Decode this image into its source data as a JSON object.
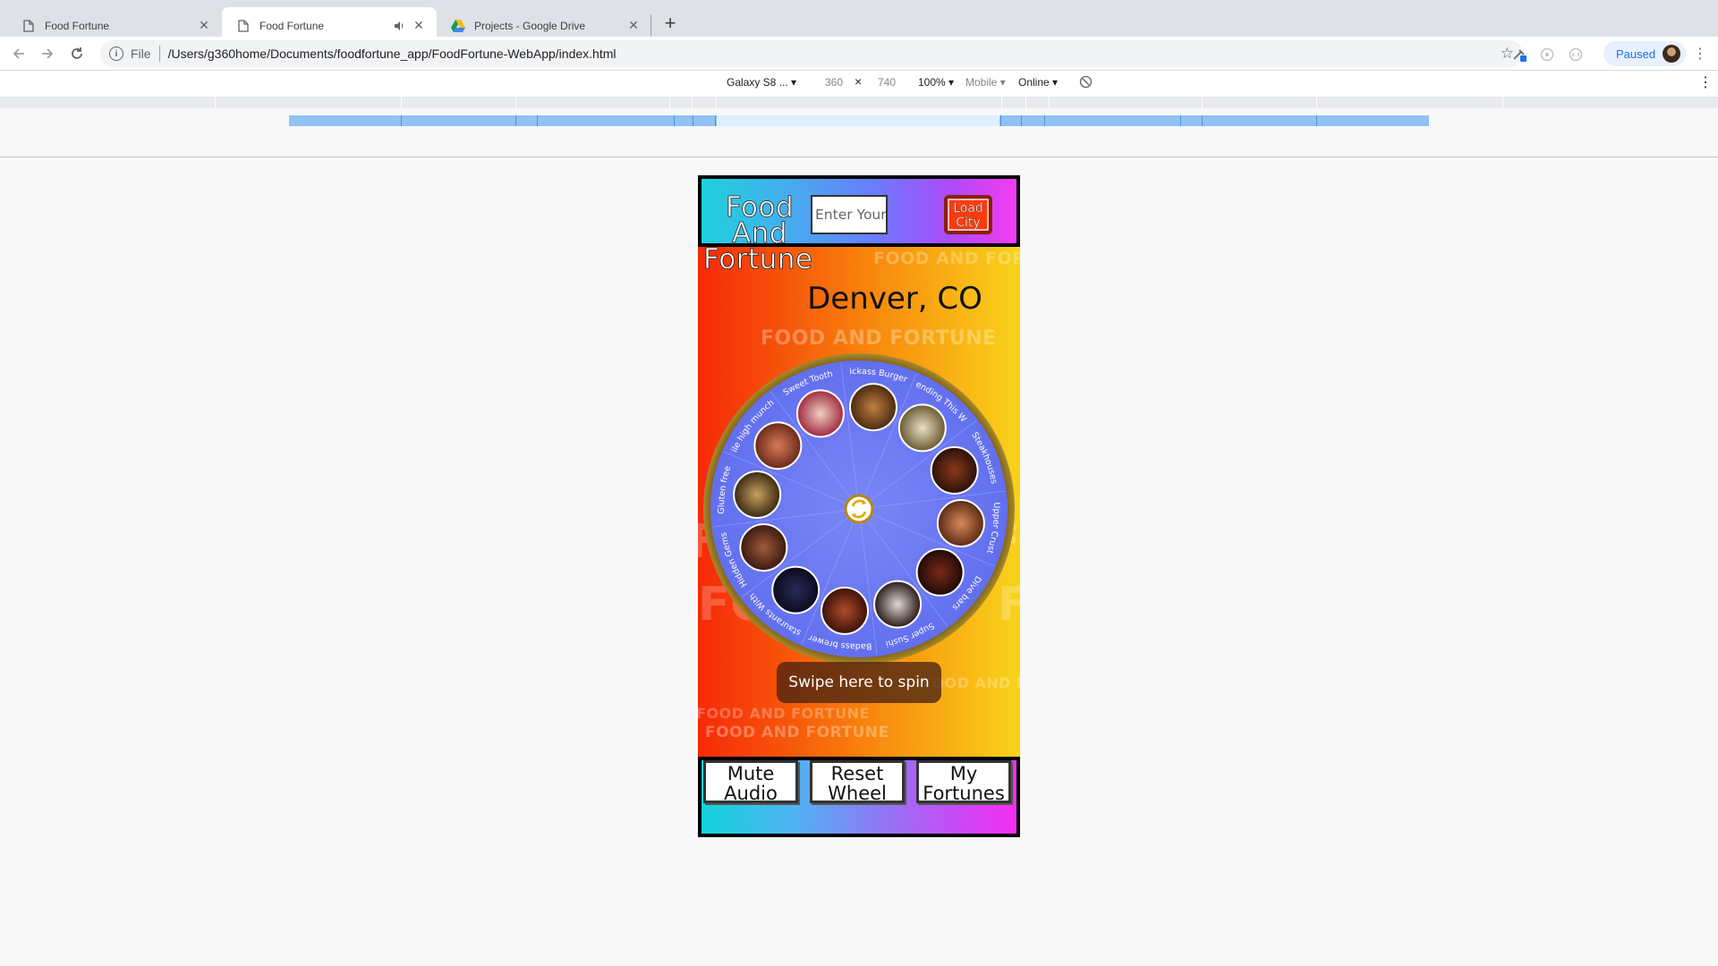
{
  "browser": {
    "tabs": [
      {
        "title": "Food Fortune",
        "active": false
      },
      {
        "title": "Food Fortune",
        "active": true,
        "audio": true
      },
      {
        "title": "Projects - Google Drive",
        "active": false
      }
    ],
    "url_scheme": "File",
    "url": "/Users/g360home/Documents/foodfortune_app/FoodFortune-WebApp/index.html",
    "profile_label": "Paused"
  },
  "devtools": {
    "device": "Galaxy S8 ...",
    "width": "360",
    "times": "×",
    "height": "740",
    "zoom": "100%",
    "mode": "Mobile",
    "network": "Online"
  },
  "app": {
    "brand": "Food And Fortune",
    "brand_line1": "Food",
    "brand_line2": "And",
    "brand_line3": "Fortune",
    "city_placeholder": "Enter Your City",
    "load_button_line1": "Load",
    "load_button_line2": "City",
    "city": "Denver, CO",
    "background_text": "FOOD AND FORTUNE",
    "swipe_hint": "Swipe here to spin",
    "wheel_segments": [
      "Kickass Burgers",
      "Trending This Wee",
      "Steakhouses",
      "Upper Crust",
      "Dive bars",
      "Super Sushi",
      "Badass brewer",
      "Restaurants With A",
      "Hidden Gems",
      "Gluten free",
      "Mile high munchie",
      "Sweet Tooth"
    ],
    "footer_buttons": [
      {
        "line1": "Mute",
        "line2": "Audio"
      },
      {
        "line1": "Reset",
        "line2": "Wheel"
      },
      {
        "line1": "My",
        "line2": "Fortunes"
      }
    ]
  },
  "colors": {
    "wheel_fill": "#6f7cf0",
    "wheel_rim": "#7a5a18",
    "load_button": "#ff3b0a"
  }
}
